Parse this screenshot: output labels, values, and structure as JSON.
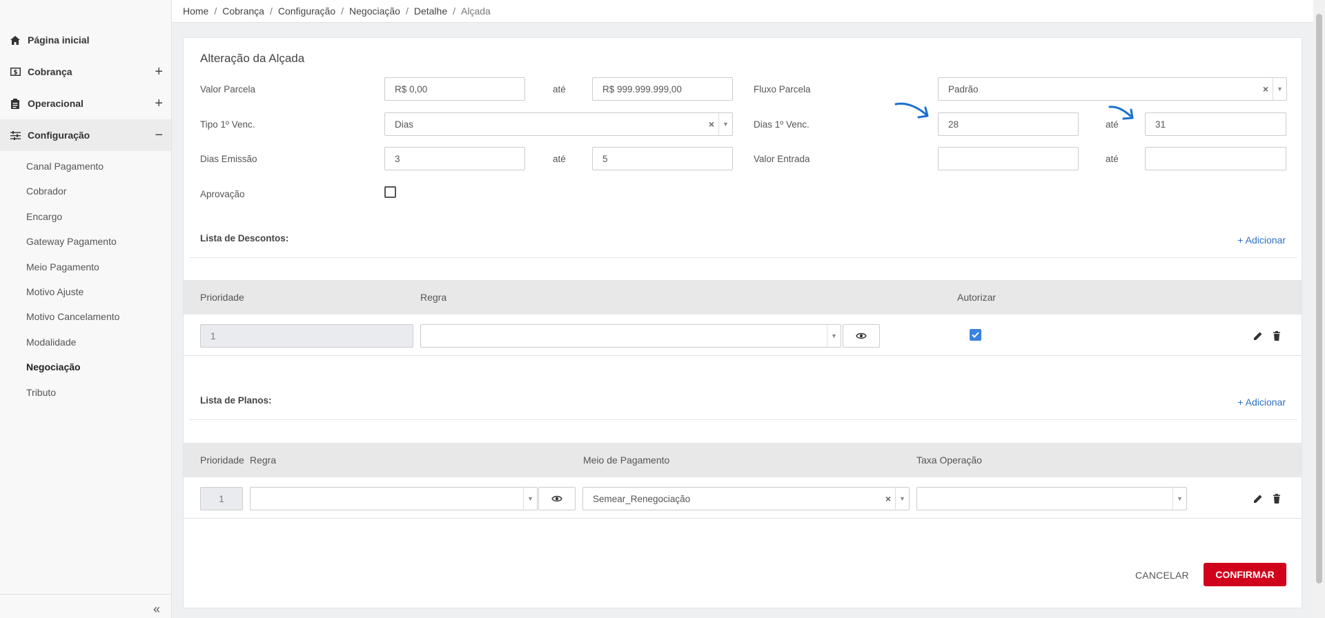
{
  "sidebar": {
    "items": [
      {
        "label": "Página inicial",
        "icon": "home-icon"
      },
      {
        "label": "Cobrança",
        "icon": "money-icon",
        "toggle": "+"
      },
      {
        "label": "Operacional",
        "icon": "clipboard-icon",
        "toggle": "+"
      },
      {
        "label": "Configuração",
        "icon": "sliders-icon",
        "toggle": "−"
      }
    ],
    "subitems": [
      "Canal Pagamento",
      "Cobrador",
      "Encargo",
      "Gateway Pagamento",
      "Meio Pagamento",
      "Motivo Ajuste",
      "Motivo Cancelamento",
      "Modalidade",
      "Negociação",
      "Tributo"
    ],
    "collapse_label": "«"
  },
  "breadcrumb": [
    "Home",
    "Cobrança",
    "Configuração",
    "Negociação",
    "Detalhe",
    "Alçada"
  ],
  "breadcrumb_sep": "/",
  "form": {
    "title": "Alteração da Alçada",
    "valor_parcela_label": "Valor Parcela",
    "valor_parcela_from": "R$ 0,00",
    "valor_parcela_to": "R$ 999.999.999,00",
    "ate_label": "até",
    "fluxo_parcela_label": "Fluxo Parcela",
    "fluxo_parcela_value": "Padrão",
    "tipo_venc_label": "Tipo 1º Venc.",
    "tipo_venc_value": "Dias",
    "dias_venc_label": "Dias 1º Venc.",
    "dias_venc_from": "28",
    "dias_venc_to": "31",
    "dias_emissao_label": "Dias Emissão",
    "dias_emissao_from": "3",
    "dias_emissao_to": "5",
    "valor_entrada_label": "Valor Entrada",
    "valor_entrada_from": "",
    "valor_entrada_to": "",
    "aprovacao_label": "Aprovação",
    "aprovacao_checked": false
  },
  "descontos": {
    "title": "Lista de Descontos:",
    "add_label": "+ Adicionar",
    "columns": [
      "Prioridade",
      "Regra",
      "Autorizar"
    ],
    "rows": [
      {
        "prioridade": "1",
        "regra": "",
        "autorizar": true
      }
    ]
  },
  "planos": {
    "title": "Lista de Planos:",
    "add_label": "+ Adicionar",
    "columns": [
      "Prioridade",
      "Regra",
      "Meio de Pagamento",
      "Taxa Operação"
    ],
    "rows": [
      {
        "prioridade": "1",
        "regra": "",
        "meio_pagamento": "Semear_Renegociação",
        "taxa_operacao": ""
      }
    ]
  },
  "actions": {
    "cancel_label": "CANCELAR",
    "confirm_label": "CONFIRMAR"
  },
  "colors": {
    "accent": "#d0021b",
    "link": "#2d6fc0",
    "checkbox": "#3b82e0",
    "annotation_arrow": "#1a6fd1"
  }
}
